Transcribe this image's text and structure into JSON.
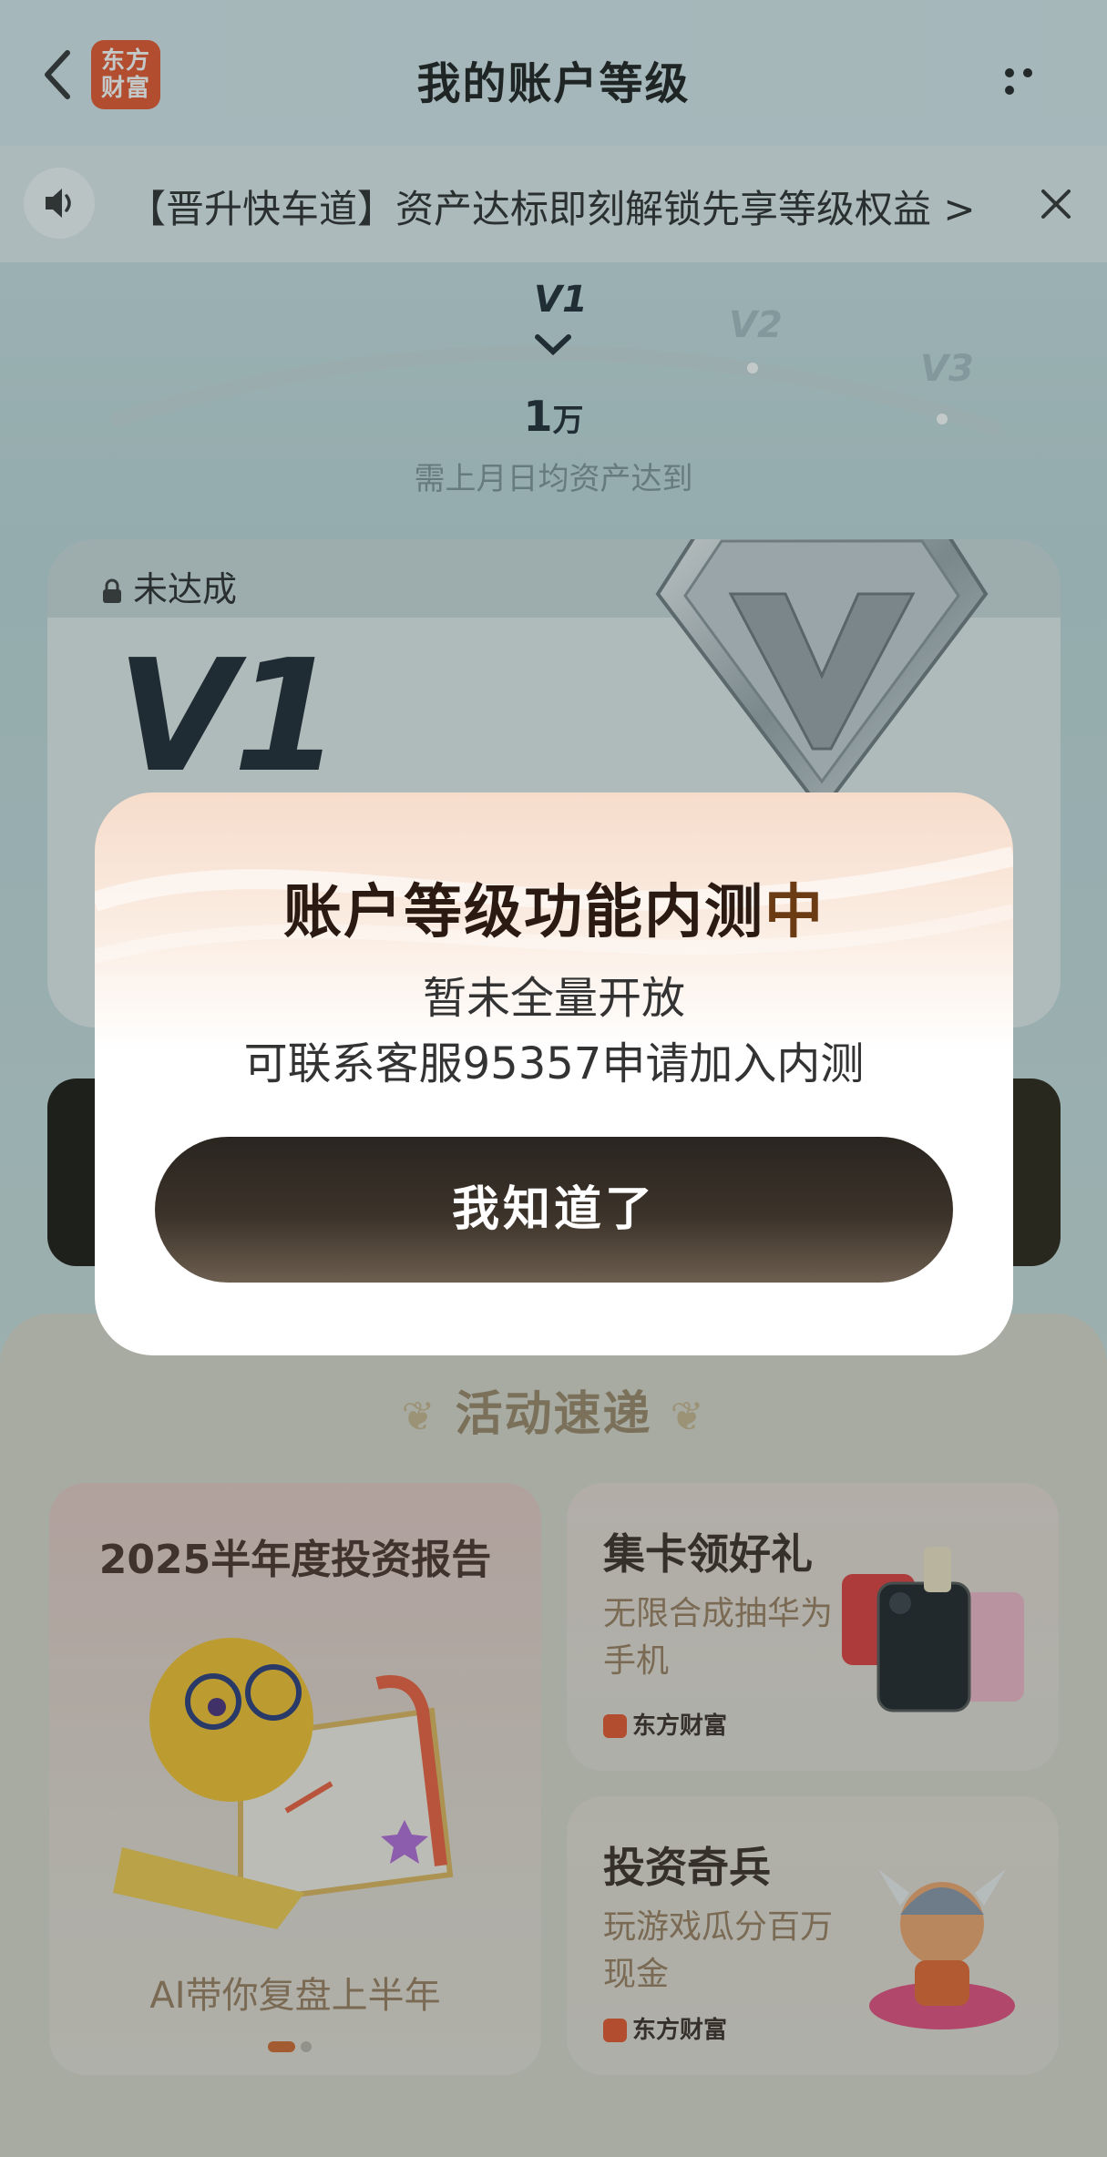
{
  "header": {
    "title": "我的账户等级",
    "logo_text": "东方财富",
    "back_icon": "chevron-left-icon",
    "more_icon": "more-dots-icon"
  },
  "notice": {
    "text": "【晋升快车道】资产达标即刻解锁先享等级权益 >",
    "speaker_icon": "speaker-icon",
    "close_icon": "close-icon"
  },
  "levels": {
    "current": "V1",
    "next": "V2",
    "next2": "V3",
    "amount_value": "1",
    "amount_unit": "万",
    "caption": "需上月日均资产达到"
  },
  "level_card": {
    "status": "未达成",
    "level": "V1"
  },
  "activity": {
    "title": "活动速递",
    "report": {
      "title": "2025半年度投资报告",
      "subtitle": "AI带你复盘上半年"
    },
    "cards": {
      "title": "集卡领好礼",
      "subtitle": "无限合成抽华为手机",
      "brand": "东方财富"
    },
    "game": {
      "title": "投资奇兵",
      "subtitle": "玩游戏瓜分百万现金",
      "brand": "东方财富"
    }
  },
  "modal": {
    "title_main": "账户等级功能内测",
    "title_highlight": "中",
    "line1": "暂未全量开放",
    "line2": "可联系客服95357申请加入内测",
    "button": "我知道了"
  },
  "colors": {
    "brand": "#e8542a",
    "button_dark": "#2a2520",
    "accent_gold": "#9b8567"
  }
}
